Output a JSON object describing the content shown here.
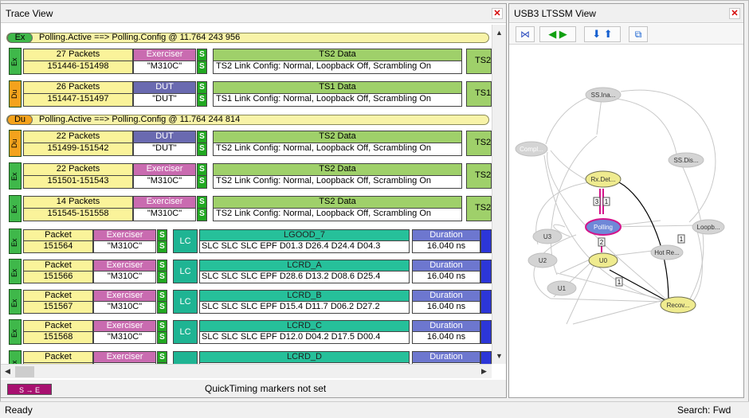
{
  "trace": {
    "title": "Trace View",
    "close": "x",
    "banners": [
      {
        "tag": "Ex",
        "text": "Polling.Active ==> Polling.Config @ 11.764 243 956"
      },
      {
        "tag": "Du",
        "text": "Polling.Active ==> Polling.Config @ 11.764 244 814"
      }
    ],
    "packets": [
      {
        "side": "Ex",
        "count": "27 Packets",
        "range": "151446-151498",
        "who": "Exerciser",
        "name": "\"M310C\"",
        "data": "TS2 Data",
        "desc": "TS2 Link Config: Normal, Loopback Off, Scrambling On",
        "next": "TS2"
      },
      {
        "side": "Du",
        "count": "26 Packets",
        "range": "151447-151497",
        "who": "DUT",
        "name": "\"DUT\"",
        "data": "TS1 Data",
        "desc": "TS1 Link Config: Normal, Loopback Off, Scrambling On",
        "next": "TS1"
      },
      {
        "side": "Du",
        "count": "22 Packets",
        "range": "151499-151542",
        "who": "DUT",
        "name": "\"DUT\"",
        "data": "TS2 Data",
        "desc": "TS2 Link Config: Normal, Loopback Off, Scrambling On",
        "next": "TS2"
      },
      {
        "side": "Ex",
        "count": "22 Packets",
        "range": "151501-151543",
        "who": "Exerciser",
        "name": "\"M310C\"",
        "data": "TS2 Data",
        "desc": "TS2 Link Config: Normal, Loopback Off, Scrambling On",
        "next": "TS2"
      },
      {
        "side": "Ex",
        "count": "14 Packets",
        "range": "151545-151558",
        "who": "Exerciser",
        "name": "\"M310C\"",
        "data": "TS2 Data",
        "desc": "TS2 Link Config: Normal, Loopback Off, Scrambling On",
        "next": "TS2"
      }
    ],
    "s": "S",
    "lc_rows": [
      {
        "side": "Ex",
        "pkt": "Packet",
        "num": "151564",
        "who": "Exerciser",
        "name": "\"M310C\"",
        "lc": "LC",
        "head": "LGOOD_7",
        "body": "SLC SLC SLC EPF D01.3 D26.4 D24.4 D04.3",
        "dur": "Duration",
        "val": "16.040 ns"
      },
      {
        "side": "Ex",
        "pkt": "Packet",
        "num": "151566",
        "who": "Exerciser",
        "name": "\"M310C\"",
        "lc": "LC",
        "head": "LCRD_A",
        "body": "SLC SLC SLC EPF D28.6 D13.2 D08.6 D25.4",
        "dur": "Duration",
        "val": "16.040 ns"
      },
      {
        "side": "Ex",
        "pkt": "Packet",
        "num": "151567",
        "who": "Exerciser",
        "name": "\"M310C\"",
        "lc": "LC",
        "head": "LCRD_B",
        "body": "SLC SLC SLC EPF D15.4 D11.7 D06.2 D27.2",
        "dur": "Duration",
        "val": "16.040 ns"
      },
      {
        "side": "Ex",
        "pkt": "Packet",
        "num": "151568",
        "who": "Exerciser",
        "name": "\"M310C\"",
        "lc": "LC",
        "head": "LCRD_C",
        "body": "SLC SLC SLC EPF D12.0 D04.2 D17.5 D00.4",
        "dur": "Duration",
        "val": "16.040 ns"
      },
      {
        "side": "Ex",
        "pkt": "Packet",
        "num": "",
        "who": "Exerciser",
        "name": "",
        "lc": "",
        "head": "LCRD_D",
        "body": "",
        "dur": "Duration",
        "val": ""
      }
    ],
    "marker_label": "S → E",
    "quicktiming": "QuickTiming markers not set"
  },
  "ltssm": {
    "title": "USB3 LTSSM View",
    "close": "x",
    "nodes": [
      "SS.Ina...",
      "Compl...",
      "SS.Dis...",
      "Rx.Det...",
      "Polling",
      "Loopb...",
      "U3",
      "Hot Re...",
      "U2",
      "U0",
      "U1",
      "Recov..."
    ],
    "edge_labels": [
      "3",
      "1",
      "2",
      "1",
      "1"
    ]
  },
  "status": {
    "left": "Ready",
    "right": "Search: Fwd"
  }
}
